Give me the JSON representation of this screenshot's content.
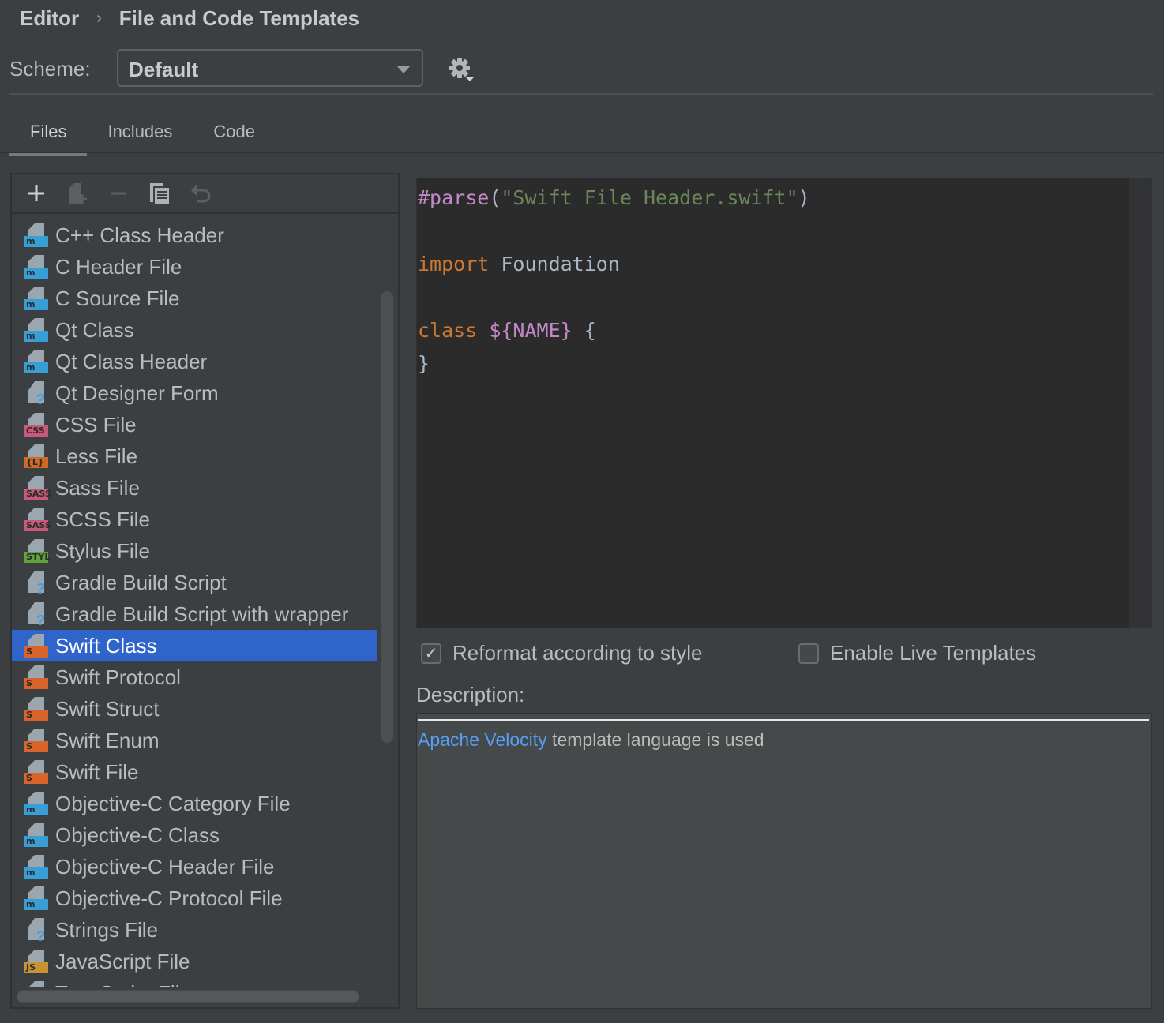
{
  "breadcrumb": {
    "parent": "Editor",
    "current": "File and Code Templates"
  },
  "scheme": {
    "label": "Scheme:",
    "value": "Default"
  },
  "tabs": [
    {
      "label": "Files",
      "active": true
    },
    {
      "label": "Includes"
    },
    {
      "label": "Code"
    }
  ],
  "toolbar": {
    "icons": [
      "plus-icon",
      "add-child-file-icon",
      "minus-icon",
      "copy-icon",
      "revert-icon"
    ]
  },
  "templates": [
    {
      "label": "C++ Class Header",
      "badge": "m",
      "color": "#389fd6"
    },
    {
      "label": "C Header File",
      "badge": "m",
      "color": "#389fd6"
    },
    {
      "label": "C Source File",
      "badge": "m",
      "color": "#389fd6"
    },
    {
      "label": "Qt Class",
      "badge": "m",
      "color": "#389fd6"
    },
    {
      "label": "Qt Class Header",
      "badge": "m",
      "color": "#389fd6"
    },
    {
      "label": "Qt Designer Form",
      "badge": "?",
      "color": ""
    },
    {
      "label": "CSS File",
      "badge": "CSS",
      "color": "#c75a7a"
    },
    {
      "label": "Less File",
      "badge": "{L}",
      "color": "#d06a24"
    },
    {
      "label": "Sass File",
      "badge": "SASS",
      "color": "#c75a7a"
    },
    {
      "label": "SCSS File",
      "badge": "SASS",
      "color": "#c75a7a"
    },
    {
      "label": "Stylus File",
      "badge": "STYL",
      "color": "#62a23a"
    },
    {
      "label": "Gradle Build Script",
      "badge": "?",
      "color": ""
    },
    {
      "label": "Gradle Build Script with wrapper",
      "badge": "?",
      "color": ""
    },
    {
      "label": "Swift Class",
      "badge": "S",
      "color": "#d9642b",
      "selected": true
    },
    {
      "label": "Swift Protocol",
      "badge": "S",
      "color": "#d9642b"
    },
    {
      "label": "Swift Struct",
      "badge": "S",
      "color": "#d9642b"
    },
    {
      "label": "Swift Enum",
      "badge": "S",
      "color": "#d9642b"
    },
    {
      "label": "Swift File",
      "badge": "S",
      "color": "#d9642b"
    },
    {
      "label": "Objective-C Category File",
      "badge": "m",
      "color": "#389fd6"
    },
    {
      "label": "Objective-C Class",
      "badge": "m",
      "color": "#389fd6"
    },
    {
      "label": "Objective-C Header File",
      "badge": "m",
      "color": "#389fd6"
    },
    {
      "label": "Objective-C Protocol File",
      "badge": "m",
      "color": "#389fd6"
    },
    {
      "label": "Strings File",
      "badge": "?",
      "color": ""
    },
    {
      "label": "JavaScript File",
      "badge": "JS",
      "color": "#c69233"
    },
    {
      "label": "TypeScript File",
      "badge": "",
      "color": "#389fd6"
    }
  ],
  "editor": {
    "lines": [
      [
        [
          "dir",
          "#parse"
        ],
        [
          "",
          "("
        ],
        [
          "str",
          "\"Swift File Header.swift\""
        ],
        [
          "",
          ")"
        ]
      ],
      [],
      [
        [
          "kw",
          "import"
        ],
        [
          "",
          " Foundation"
        ]
      ],
      [],
      [
        [
          "kw",
          "class"
        ],
        [
          "",
          " "
        ],
        [
          "var",
          "${NAME}"
        ],
        [
          "",
          " {"
        ]
      ],
      [
        [
          "",
          "}"
        ]
      ]
    ]
  },
  "options": {
    "reformat": {
      "label": "Reformat according to style",
      "checked": true
    },
    "live_templates": {
      "label": "Enable Live Templates",
      "checked": false
    }
  },
  "description": {
    "label": "Description:",
    "link": "Apache Velocity",
    "text": " template language is used"
  }
}
